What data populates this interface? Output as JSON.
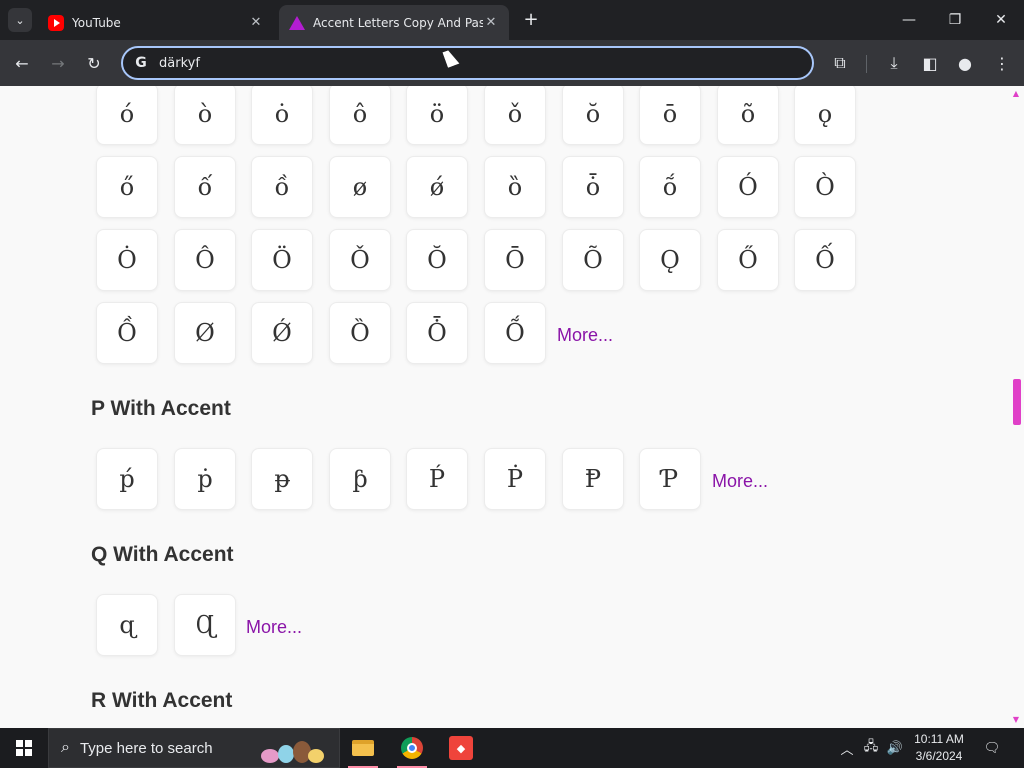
{
  "tabs": [
    {
      "title": "YouTube",
      "icon": "youtube-icon"
    },
    {
      "title": "Accent Letters Copy And Paste",
      "icon": "site-triangle-icon"
    }
  ],
  "toolbar": {
    "address": "därkyf",
    "search_engine_icon": "G"
  },
  "o_grid": {
    "rows": [
      [
        "ó",
        "ò",
        "ȯ",
        "ô",
        "ö",
        "ǒ",
        "ŏ",
        "ō",
        "õ",
        "ǫ"
      ],
      [
        "ő",
        "ố",
        "ồ",
        "ø",
        "ǿ",
        "ȍ",
        "ȱ",
        "ṍ",
        "Ó",
        "Ò"
      ],
      [
        "Ȯ",
        "Ô",
        "Ö",
        "Ǒ",
        "Ŏ",
        "Ō",
        "Õ",
        "Ǫ",
        "Ő",
        "Ố"
      ],
      [
        "Ồ",
        "Ø",
        "Ǿ",
        "Ȍ",
        "Ȱ",
        "Ṍ"
      ]
    ],
    "more": "More..."
  },
  "p_section": {
    "heading": "P With Accent",
    "letters": [
      "ṕ",
      "ṗ",
      "ᵽ",
      "ƥ",
      "Ṕ",
      "Ṗ",
      "Ᵽ",
      "Ƥ"
    ],
    "more": "More..."
  },
  "q_section": {
    "heading": "Q With Accent",
    "letters": [
      "ɋ",
      "Ɋ"
    ],
    "more": "More..."
  },
  "r_section": {
    "heading": "R With Accent"
  },
  "taskbar": {
    "search_placeholder": "Type here to search",
    "time": "10:11 AM",
    "date": "3/6/2024"
  },
  "colors": {
    "accent_link": "#8a14a8",
    "scroll_thumb": "#e040c8",
    "omnibox_border": "#a8c7fa"
  }
}
